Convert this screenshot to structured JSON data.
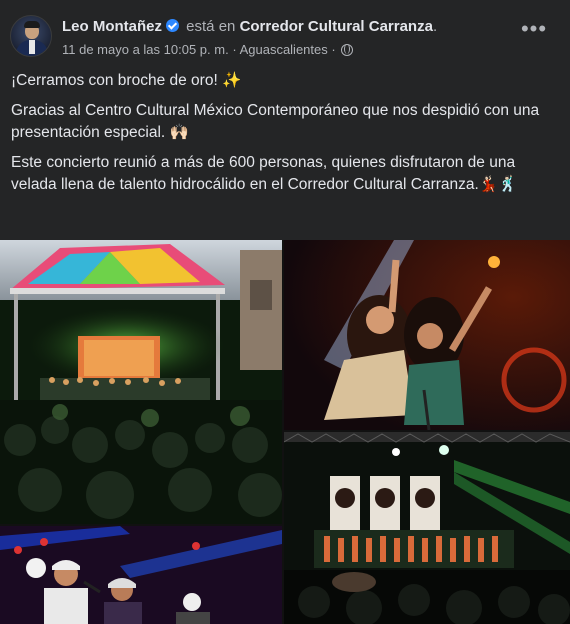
{
  "post": {
    "author": "Leo Montañez",
    "verb": "está en",
    "location": "Corredor Cultural Carranza",
    "period": ".",
    "timestamp": "11 de mayo a las 10:05 p. m.",
    "separator": "·",
    "place": "Aguascalientes",
    "separator2": "·",
    "more_label": "•••",
    "paragraphs": [
      "¡Cerramos con broche de oro! ✨",
      "Gracias al Centro Cultural México Contemporáneo que nos despidió con una presentación especial. 🙌🏻",
      "Este concierto reunió a más de 600 personas, quienes disfrutaron de una velada llena de talento hidrocálido en el Corredor Cultural Carranza.💃🏻🕺🏻"
    ]
  },
  "icons": {
    "verified": "verified-badge-icon",
    "privacy": "globe-icon",
    "more": "more-options-icon"
  },
  "colors": {
    "card_bg": "#242526",
    "text_primary": "#e4e6eb",
    "text_secondary": "#b0b3b8",
    "verified_blue": "#2d88ff"
  }
}
